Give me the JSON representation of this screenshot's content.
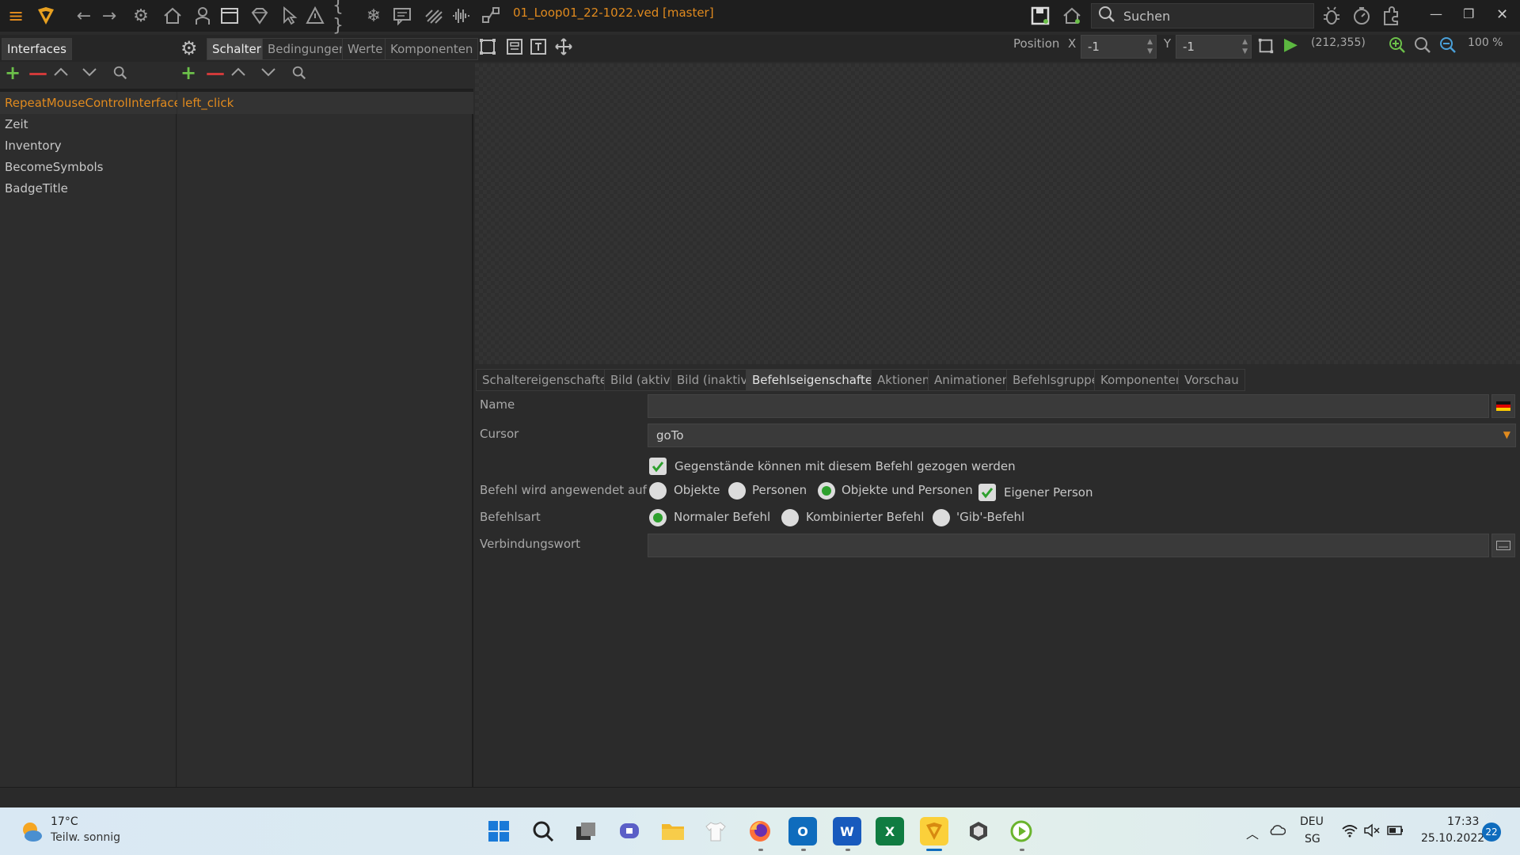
{
  "app": {
    "file_title": "01_Loop01_22-1022.ved [master]",
    "search_placeholder": "Suchen"
  },
  "left_tabs": {
    "interfaces": "Interfaces",
    "schalter": "Schalter",
    "bedingungen": "Bedingungen",
    "werte": "Werte",
    "komponenten": "Komponenten"
  },
  "position": {
    "label": "Position",
    "x_label": "X",
    "x_value": "-1",
    "y_label": "Y",
    "y_value": "-1",
    "coords": "(212,355)",
    "zoom": "100 %"
  },
  "interfaces": [
    "RepeatMouseControlInterface",
    "Zeit",
    "Inventory",
    "BecomeSymbols",
    "BadgeTitle"
  ],
  "buttons": [
    "left_click"
  ],
  "prop_tabs": [
    "Schaltereigenschaften",
    "Bild (aktiv)",
    "Bild (inaktiv)",
    "Befehlseigenschaften",
    "Aktionen",
    "Animationen",
    "Befehlsgruppe",
    "Komponenten",
    "Vorschau"
  ],
  "props": {
    "name_label": "Name",
    "name_value": "",
    "cursor_label": "Cursor",
    "cursor_value": "goTo",
    "drag_label": "Gegenstände können mit diesem Befehl gezogen werden",
    "drag_checked": true,
    "applied_label": "Befehl wird angewendet auf",
    "applied_options": [
      "Objekte",
      "Personen",
      "Objekte und Personen"
    ],
    "applied_selected": "Objekte und Personen",
    "own_person_label": "Eigener Person",
    "own_person_checked": true,
    "type_label": "Befehlsart",
    "type_options": [
      "Normaler Befehl",
      "Kombinierter Befehl",
      "'Gib'-Befehl"
    ],
    "type_selected": "Normaler Befehl",
    "connect_label": "Verbindungswort",
    "connect_value": ""
  },
  "taskbar": {
    "weather_temp": "17°C",
    "weather_desc": "Teilw. sonnig",
    "lang_top": "DEU",
    "lang_bottom": "SG",
    "time": "17:33",
    "date": "25.10.2022",
    "notifications": "22"
  },
  "colors": {
    "accent_orange": "#e08a1e",
    "green": "#6cc04a",
    "red": "#d03a3a"
  }
}
